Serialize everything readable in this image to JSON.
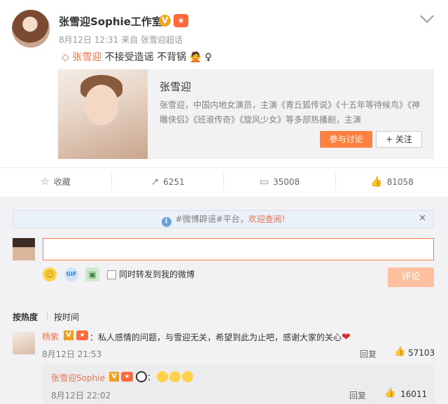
{
  "post": {
    "author": "张雪迎Sophie工作室",
    "verified_mark": "V",
    "time": "8月12日 12:31",
    "source": "来自 张雪迎超话",
    "topic": "张雪迎",
    "text": "不接受造谣 不背锅",
    "gender_symbol": "♀"
  },
  "card": {
    "title": "张雪迎",
    "desc": "张雪迎，中国内地女演员，主演《青丘狐传说》《十五年等待候鸟》《神雕侠侣》《班淑传奇》《旋风少女》等多部热播剧，主演",
    "join_label": "参与讨论",
    "follow_label": "+ 关注"
  },
  "actions": {
    "collect": "收藏",
    "repost": "6251",
    "comments": "35008",
    "likes": "81058"
  },
  "notice": {
    "tag": "#微博辟谣#平台，",
    "link": "欢迎查阅!",
    "close": "×"
  },
  "composer": {
    "placeholder": "",
    "sync_label": "同时转发到我的微博",
    "submit_label": "评论"
  },
  "sort": {
    "hot": "按热度",
    "time": "按时间"
  },
  "comment": {
    "name": "杨紫",
    "text": "：私人感情的问题，与雪迎无关，希望到此为止吧，感谢大家的关心",
    "time": "8月12日 21:53",
    "reply": "回复",
    "likes": "57103"
  },
  "subcomment": {
    "name": "张雪迎Sophie",
    "text": "：",
    "time": "8月12日 22:02",
    "reply": "回复",
    "likes": "16011"
  },
  "colors": {
    "accent": "#eb7350",
    "button": "#ff8140",
    "link_blue": "#6aa1d8"
  }
}
